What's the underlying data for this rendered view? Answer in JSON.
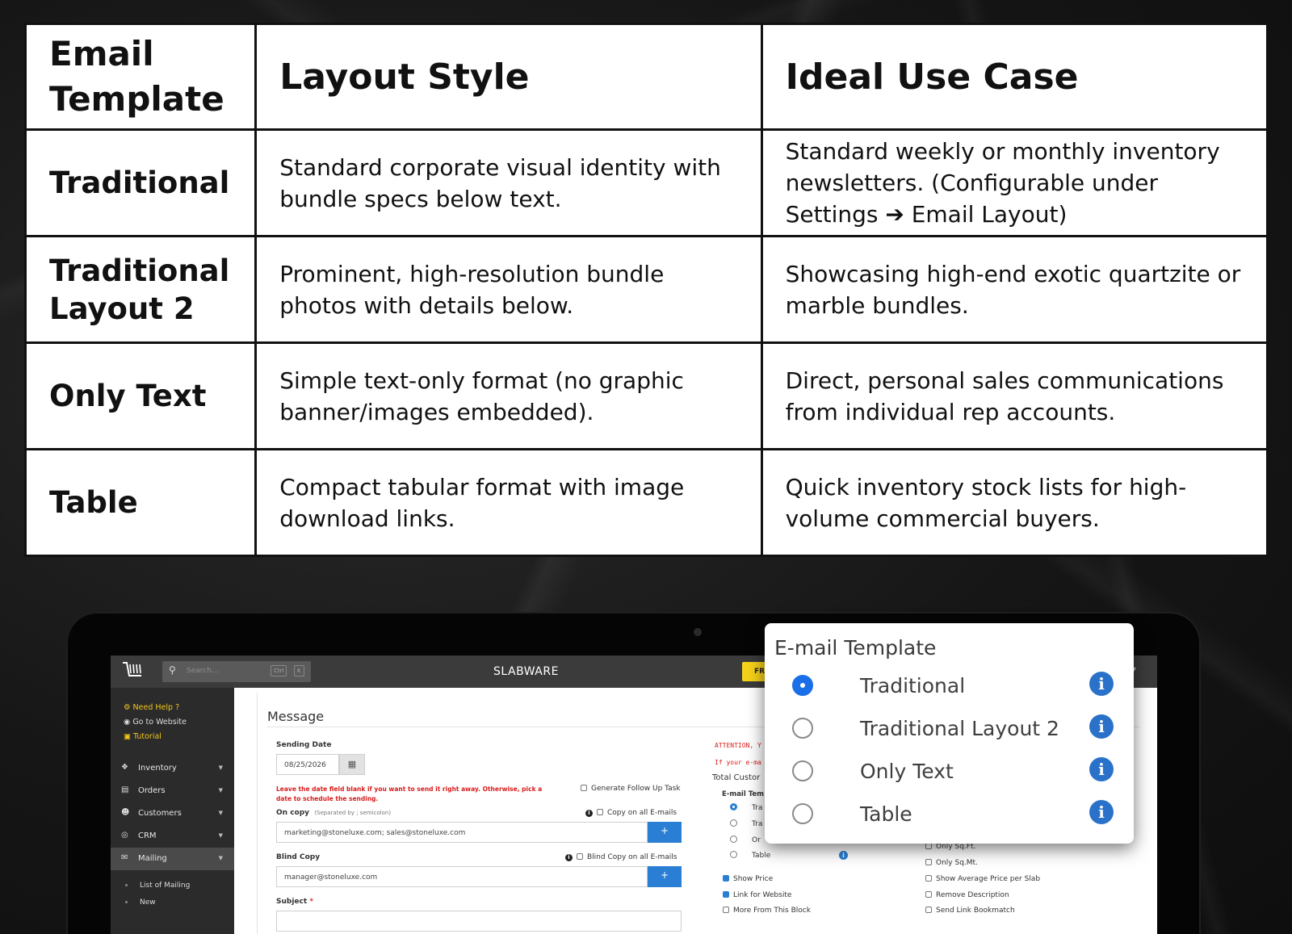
{
  "table": {
    "headers": [
      "Email Template",
      "Layout Style",
      "Ideal Use Case"
    ],
    "header_line1": "Email",
    "header_line2": "Template",
    "rows": [
      {
        "name": "Traditional",
        "layout": "Standard corporate visual identity with bundle specs below text.",
        "use": "Standard weekly or monthly inventory newsletters. (Configurable under Settings ➔ Email Layout)"
      },
      {
        "name_line1": "Traditional",
        "name_line2": "Layout 2",
        "layout": "Prominent, high-resolution bundle photos with details below.",
        "use": "Showcasing high-end exotic quartzite or marble bundles."
      },
      {
        "name": "Only Text",
        "layout": "Simple text-only format (no graphic banner/images embedded).",
        "use": "Direct, personal sales communications from individual rep accounts."
      },
      {
        "name": "Table",
        "layout": "Compact tabular format with image download links.",
        "use": "Quick inventory stock lists for high-volume commercial buyers."
      }
    ]
  },
  "app": {
    "brand": "SLABWARE",
    "search_placeholder": "Search...",
    "kbd1": "Ctrl",
    "kbd2": "K",
    "fr_btn": "FR",
    "help": {
      "need_help": "Need Help ?",
      "go_website": "Go to Website",
      "tutorial": "Tutorial"
    },
    "menu": [
      "Inventory",
      "Orders",
      "Customers",
      "CRM",
      "Mailing"
    ],
    "submenu": [
      "List of Mailing",
      "New"
    ],
    "message_title": "Message",
    "sending_date_label": "Sending Date",
    "sending_date_value": "08/25/2026",
    "warning": "Leave the date field blank if you want to send it right away. Otherwise, pick a date to schedule the sending.",
    "follow_up": "Generate Follow Up Task",
    "on_copy_label": "On copy",
    "on_copy_hint": "(Separated by ; semicolon)",
    "copy_all": "Copy on all E-mails",
    "on_copy_value": "marketing@stoneluxe.com; sales@stoneluxe.com",
    "blind_copy_label": "Blind Copy",
    "blind_copy_all": "Blind Copy on all E-mails",
    "blind_copy_value": "manager@stoneluxe.com",
    "subject_label": "Subject",
    "subject_req": "*",
    "plus": "+",
    "attention": "ATTENTION, Y",
    "if_email": "If your e-ma",
    "total_customers": "Total Custor",
    "email_template_small": "E-mail Tem",
    "template_small": [
      "Tra",
      "Tra",
      "Or",
      "Table"
    ],
    "checks_left": [
      "Show Price",
      "Link for Website",
      "More From This Block"
    ],
    "checks_right": [
      "Only Sq.Ft.",
      "Only Sq.Mt.",
      "Show Average Price per Slab",
      "Remove Description",
      "Send Link Bookmatch"
    ]
  },
  "popup": {
    "title": "E-mail Template",
    "options": [
      "Traditional",
      "Traditional Layout 2",
      "Only Text",
      "Table"
    ],
    "selected": 0,
    "info_glyph": "i"
  }
}
